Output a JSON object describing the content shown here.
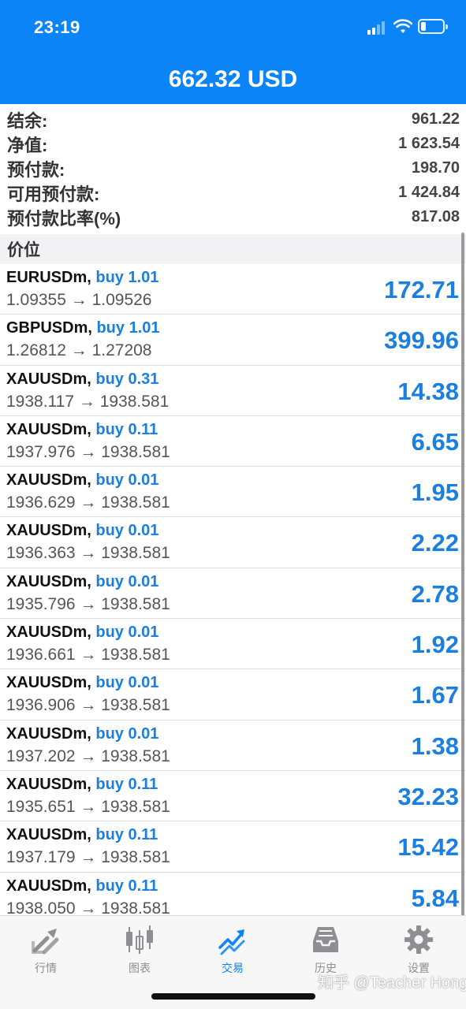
{
  "status_bar": {
    "time": "23:19"
  },
  "header": {
    "title": "662.32 USD"
  },
  "account": [
    {
      "label": "结余:",
      "value": "961.22"
    },
    {
      "label": "净值:",
      "value": "1 623.54"
    },
    {
      "label": "预付款:",
      "value": "198.70"
    },
    {
      "label": "可用预付款:",
      "value": "1 424.84"
    },
    {
      "label": "预付款比率(%)",
      "value": "817.08"
    }
  ],
  "section_title": "价位",
  "positions": [
    {
      "symbol": "EURUSDm,",
      "side": "buy 1.01",
      "prices": "1.09355 → 1.09526",
      "profit": "172.71"
    },
    {
      "symbol": "GBPUSDm,",
      "side": "buy 1.01",
      "prices": "1.26812 → 1.27208",
      "profit": "399.96"
    },
    {
      "symbol": "XAUUSDm,",
      "side": "buy 0.31",
      "prices": "1938.117 → 1938.581",
      "profit": "14.38"
    },
    {
      "symbol": "XAUUSDm,",
      "side": "buy 0.11",
      "prices": "1937.976 → 1938.581",
      "profit": "6.65"
    },
    {
      "symbol": "XAUUSDm,",
      "side": "buy 0.01",
      "prices": "1936.629 → 1938.581",
      "profit": "1.95"
    },
    {
      "symbol": "XAUUSDm,",
      "side": "buy 0.01",
      "prices": "1936.363 → 1938.581",
      "profit": "2.22"
    },
    {
      "symbol": "XAUUSDm,",
      "side": "buy 0.01",
      "prices": "1935.796 → 1938.581",
      "profit": "2.78"
    },
    {
      "symbol": "XAUUSDm,",
      "side": "buy 0.01",
      "prices": "1936.661 → 1938.581",
      "profit": "1.92"
    },
    {
      "symbol": "XAUUSDm,",
      "side": "buy 0.01",
      "prices": "1936.906 → 1938.581",
      "profit": "1.67"
    },
    {
      "symbol": "XAUUSDm,",
      "side": "buy 0.01",
      "prices": "1937.202 → 1938.581",
      "profit": "1.38"
    },
    {
      "symbol": "XAUUSDm,",
      "side": "buy 0.11",
      "prices": "1935.651 → 1938.581",
      "profit": "32.23"
    },
    {
      "symbol": "XAUUSDm,",
      "side": "buy 0.11",
      "prices": "1937.179 → 1938.581",
      "profit": "15.42"
    },
    {
      "symbol": "XAUUSDm,",
      "side": "buy 0.11",
      "prices": "1938.050 → 1938.581",
      "profit": "5.84"
    }
  ],
  "tabs": [
    {
      "label": "行情",
      "icon": "quotes-arrows-icon"
    },
    {
      "label": "图表",
      "icon": "candlestick-chart-icon"
    },
    {
      "label": "交易",
      "icon": "trade-trend-icon",
      "active": true
    },
    {
      "label": "历史",
      "icon": "history-inbox-icon"
    },
    {
      "label": "设置",
      "icon": "gear-icon"
    }
  ],
  "watermark": "知乎 @Teacher Hong",
  "colors": {
    "header_bg": "#0a84f7",
    "accent": "#1a7fe0",
    "tab_inactive": "#8e8e93"
  }
}
